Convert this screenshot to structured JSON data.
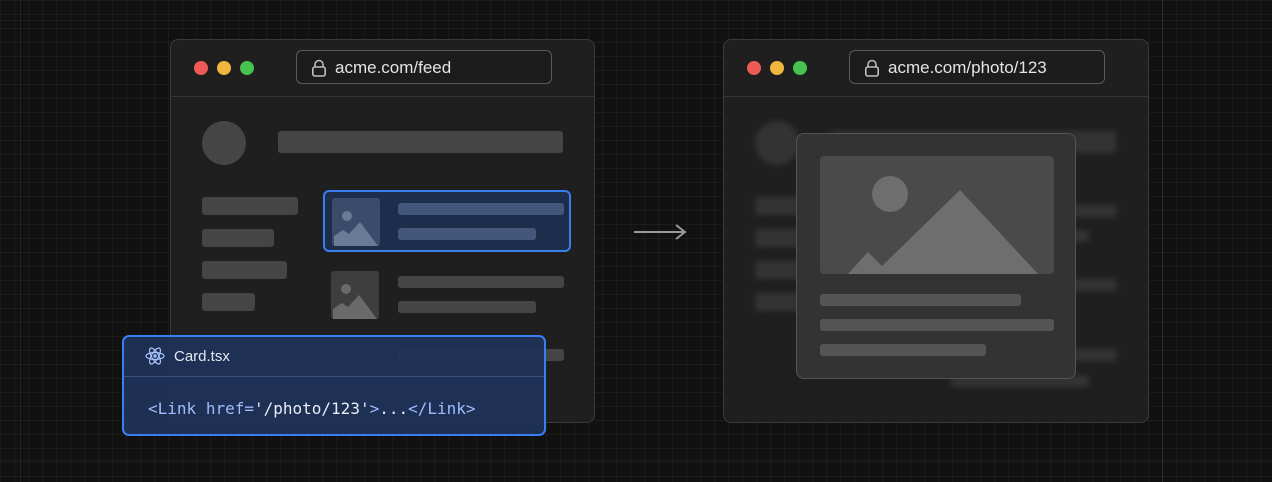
{
  "left_window": {
    "url": "acme.com/feed"
  },
  "right_window": {
    "url": "acme.com/photo/123"
  },
  "code_panel": {
    "filename": "Card.tsx",
    "code": {
      "open_tag": "<Link",
      "attr_name": "href=",
      "attr_value": "'/photo/123'",
      "close_bracket": ">",
      "content": "...",
      "close_tag": "</Link>"
    }
  },
  "icons": {
    "lock": "lock-icon",
    "image": "image-placeholder-icon",
    "react": "react-icon",
    "arrow": "arrow-right-icon"
  },
  "colors": {
    "background": "#111111",
    "window": "#1f1f1f",
    "accent": "#3a7ff0",
    "traffic_red": "#ee5b57",
    "traffic_yellow": "#f1b63e",
    "traffic_green": "#45c24f"
  }
}
